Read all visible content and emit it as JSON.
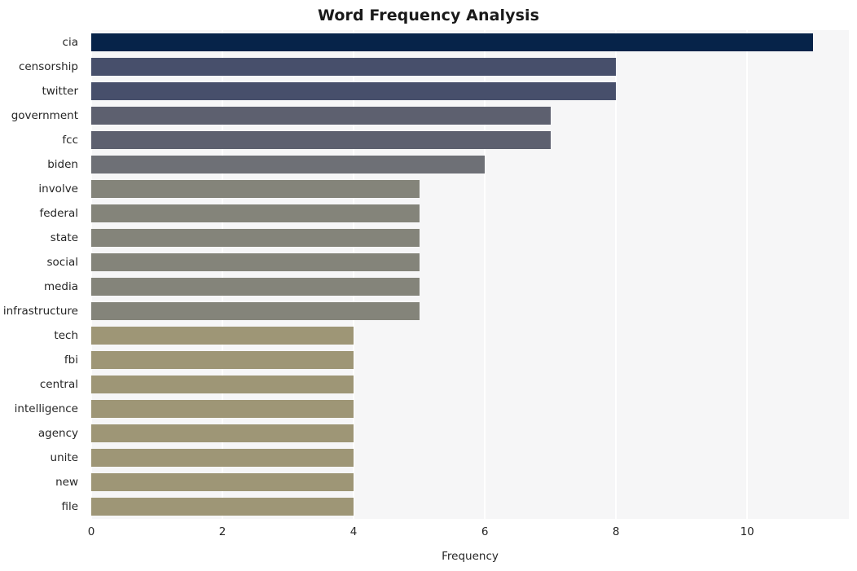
{
  "chart_data": {
    "type": "bar",
    "orientation": "horizontal",
    "title": "Word Frequency Analysis",
    "xlabel": "Frequency",
    "ylabel": "",
    "xlim": [
      0,
      11.55
    ],
    "xticks": [
      0,
      2,
      4,
      6,
      8,
      10
    ],
    "xtick_labels": [
      "0",
      "2",
      "4",
      "6",
      "8",
      "10"
    ],
    "grid": "vertical",
    "legend": "none",
    "categories": [
      "cia",
      "censorship",
      "twitter",
      "government",
      "fcc",
      "biden",
      "involve",
      "federal",
      "state",
      "social",
      "media",
      "infrastructure",
      "tech",
      "fbi",
      "central",
      "intelligence",
      "agency",
      "unite",
      "new",
      "file"
    ],
    "values": [
      11,
      8,
      8,
      7,
      7,
      6,
      5,
      5,
      5,
      5,
      5,
      5,
      4,
      4,
      4,
      4,
      4,
      4,
      4,
      4
    ],
    "bar_colors": [
      "#062349",
      "#474f6b",
      "#474f6b",
      "#5d606f",
      "#5d606f",
      "#6e7076",
      "#84847a",
      "#84847a",
      "#84847a",
      "#84847a",
      "#84847a",
      "#84847a",
      "#9e9676",
      "#9e9676",
      "#9e9676",
      "#9e9676",
      "#9e9676",
      "#9e9676",
      "#9e9676",
      "#9e9676"
    ]
  },
  "style": {
    "figure_background": "#ffffff",
    "plot_background": "#f6f6f7",
    "gridline_color": "#ffffff",
    "text_color": "#262626",
    "title_color": "#1a1a1a"
  }
}
